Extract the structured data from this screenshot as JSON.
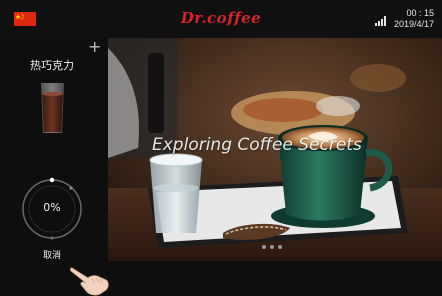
{
  "header": {
    "brand": "Dr.coffee",
    "time": "00 : 15",
    "date": "2019/4/17",
    "flag_icon": "china-flag-icon",
    "signal_icon": "signal-bars-icon"
  },
  "sidebar": {
    "add_icon": "plus-icon",
    "drink_name": "热巧克力",
    "drink_icon": "hot-chocolate-cup-icon",
    "progress": {
      "value": 0,
      "label": "0%"
    },
    "cancel_label": "取消",
    "hand_icon": "pointing-hand-icon"
  },
  "slideshow": {
    "caption": "Exploring Coffee Secrets",
    "slide_count": 3
  },
  "colors": {
    "brand": "#d8232a",
    "flag": "#de2910",
    "background": "#0e0e0e"
  }
}
